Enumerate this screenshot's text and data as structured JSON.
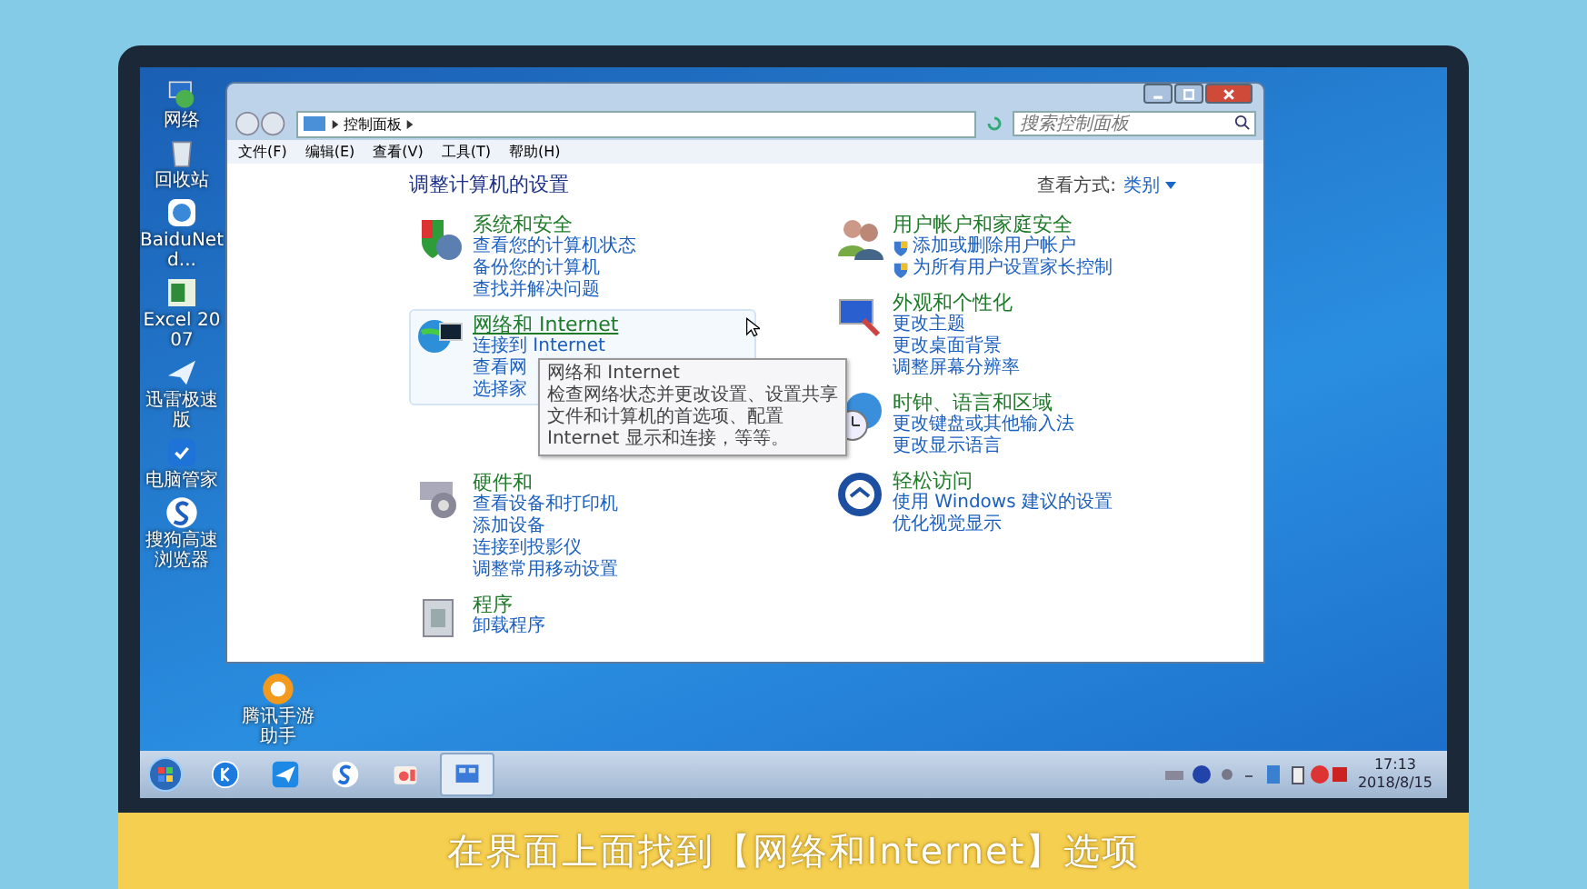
{
  "desktop_icons": [
    {
      "label": "网络",
      "kind": "network"
    },
    {
      "label": "回收站",
      "kind": "bin"
    },
    {
      "label": "BaiduNetd...",
      "kind": "cloud"
    },
    {
      "label": "Excel 2007",
      "kind": "excel"
    },
    {
      "label": "迅雷极速版",
      "kind": "bird"
    },
    {
      "label": "电脑管家",
      "kind": "shield"
    },
    {
      "label": "搜狗高速浏览器",
      "kind": "sogou"
    }
  ],
  "desktop_icon_extra": {
    "label": "腾讯手游助手",
    "kind": "tencent"
  },
  "window": {
    "breadcrumb": "控制面板",
    "search": {
      "placeholder": "搜索控制面板"
    },
    "menu": [
      "文件(F)",
      "编辑(E)",
      "查看(V)",
      "工具(T)",
      "帮助(H)"
    ],
    "title": "调整计算机的设置",
    "view_label": "查看方式:",
    "view_value": "类别",
    "columns": [
      [
        {
          "kind": "security",
          "heading": "系统和安全",
          "hovered": false,
          "links": [
            {
              "label": "查看您的计算机状态",
              "shield": false
            },
            {
              "label": "备份您的计算机",
              "shield": false
            },
            {
              "label": "查找并解决问题",
              "shield": false
            }
          ]
        },
        {
          "kind": "network",
          "heading": "网络和 Internet",
          "hovered": true,
          "links": [
            {
              "label": "连接到 Internet",
              "shield": false
            },
            {
              "label": "查看网",
              "shield": false
            },
            {
              "label": "选择家",
              "shield": false
            }
          ]
        },
        {
          "kind": "hardware",
          "heading": "硬件和",
          "hovered": false,
          "links": [
            {
              "label": "查看设备和打印机",
              "shield": false
            },
            {
              "label": "添加设备",
              "shield": false
            },
            {
              "label": "连接到投影仪",
              "shield": false
            },
            {
              "label": "调整常用移动设置",
              "shield": false
            }
          ]
        },
        {
          "kind": "programs",
          "heading": "程序",
          "hovered": false,
          "links": [
            {
              "label": "卸载程序",
              "shield": false
            }
          ]
        }
      ],
      [
        {
          "kind": "users",
          "heading": "用户帐户和家庭安全",
          "hovered": false,
          "links": [
            {
              "label": "添加或删除用户帐户",
              "shield": true
            },
            {
              "label": "为所有用户设置家长控制",
              "shield": true
            }
          ]
        },
        {
          "kind": "appearance",
          "heading": "外观和个性化",
          "hovered": false,
          "links": [
            {
              "label": "更改主题",
              "shield": false
            },
            {
              "label": "更改桌面背景",
              "shield": false
            },
            {
              "label": "调整屏幕分辨率",
              "shield": false
            }
          ]
        },
        {
          "kind": "clock",
          "heading": "时钟、语言和区域",
          "hovered": false,
          "links": [
            {
              "label": "更改键盘或其他输入法",
              "shield": false
            },
            {
              "label": "更改显示语言",
              "shield": false
            }
          ]
        },
        {
          "kind": "access",
          "heading": "轻松访问",
          "hovered": false,
          "links": [
            {
              "label": "使用 Windows 建议的设置",
              "shield": false
            },
            {
              "label": "优化视觉显示",
              "shield": false
            }
          ]
        }
      ]
    ],
    "tooltip": {
      "title": "网络和 Internet",
      "text": "检查网络状态并更改设置、设置共享文件和计算机的首选项、配置 Internet 显示和连接，等等。"
    }
  },
  "taskbar": {
    "apps": [
      {
        "kind": "k",
        "active": false
      },
      {
        "kind": "bird",
        "active": false
      },
      {
        "kind": "s",
        "active": false
      },
      {
        "kind": "camera",
        "active": false
      },
      {
        "kind": "panel",
        "active": true
      }
    ],
    "time": "17:13",
    "date": "2018/8/15"
  },
  "caption": "在界面上面找到【网络和Internet】选项"
}
